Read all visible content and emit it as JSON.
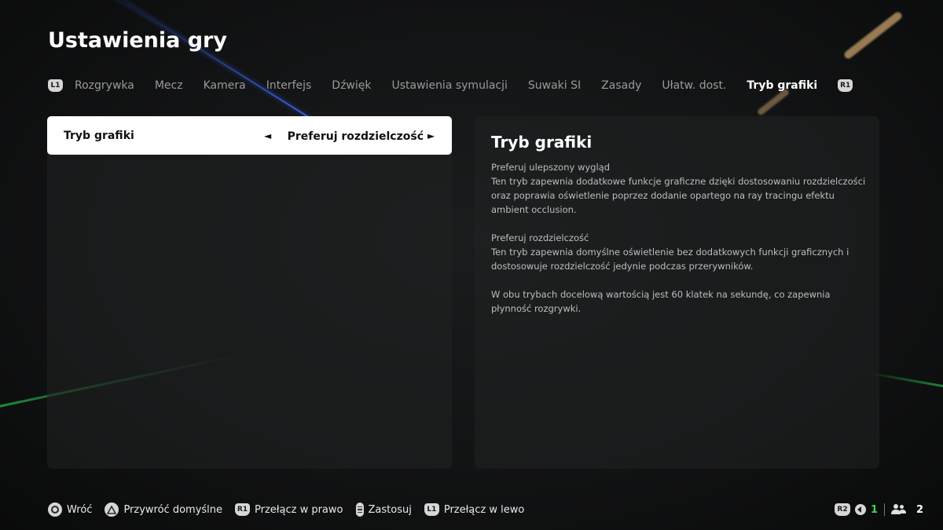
{
  "page": {
    "title": "Ustawienia gry"
  },
  "tabs": {
    "left_bumper": "L1",
    "right_bumper": "R1",
    "items": [
      {
        "label": "Rozgrywka"
      },
      {
        "label": "Mecz"
      },
      {
        "label": "Kamera"
      },
      {
        "label": "Interfejs"
      },
      {
        "label": "Dźwięk"
      },
      {
        "label": "Ustawienia symulacji"
      },
      {
        "label": "Suwaki SI"
      },
      {
        "label": "Zasady"
      },
      {
        "label": "Ułatw. dost."
      },
      {
        "label": "Tryb grafiki"
      }
    ],
    "active": "Tryb grafiki"
  },
  "setting": {
    "label": "Tryb grafiki",
    "value": "Preferuj rozdzielczość",
    "arrow_left": "◄",
    "arrow_right": "►"
  },
  "description": {
    "title": "Tryb grafiki",
    "paragraphs": [
      "Preferuj ulepszony wygląd\nTen tryb zapewnia dodatkowe funkcje graficzne dzięki dostosowaniu rozdzielczości oraz poprawia oświetlenie poprzez dodanie opartego na ray tracingu efektu ambient occlusion.",
      "Preferuj rozdzielczość\nTen tryb zapewnia domyślne oświetlenie bez dodatkowych funkcji graficznych i dostosowuje rozdzielczość jedynie podczas przerywników.",
      "W obu trybach docelową wartością jest 60 klatek na sekundę, co zapewnia płynność rozgrywki."
    ]
  },
  "footer": {
    "back": "Wróć",
    "restore": "Przywróć domyślne",
    "r1_badge": "R1",
    "switch_right": "Przełącz w prawo",
    "apply": "Zastosuj",
    "l1_badge": "L1",
    "switch_left": "Przełącz w lewo"
  },
  "status": {
    "r2_badge": "R2",
    "local_count": "1",
    "online_count": "2",
    "accent_green": "#40d35a"
  }
}
